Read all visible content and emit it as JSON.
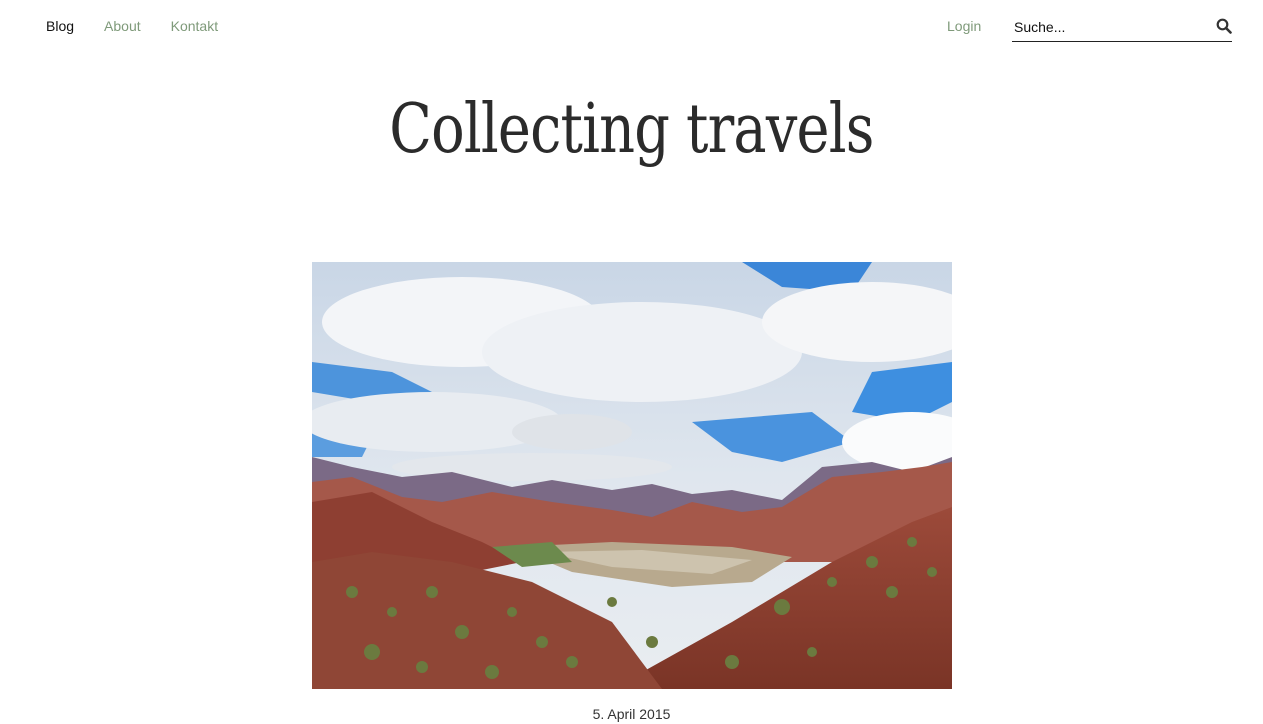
{
  "nav": {
    "items": [
      {
        "label": "Blog",
        "active": true
      },
      {
        "label": "About",
        "active": false
      },
      {
        "label": "Kontakt",
        "active": false
      }
    ],
    "login_label": "Login"
  },
  "search": {
    "placeholder": "Suche...",
    "icon": "search-icon"
  },
  "site": {
    "title": "Collecting travels"
  },
  "post": {
    "image_icon": "landscape-photo",
    "date": "5. April 2015"
  },
  "colors": {
    "nav_link": "#7f9a7a",
    "nav_active": "#111111",
    "title": "#2b2b2b"
  }
}
